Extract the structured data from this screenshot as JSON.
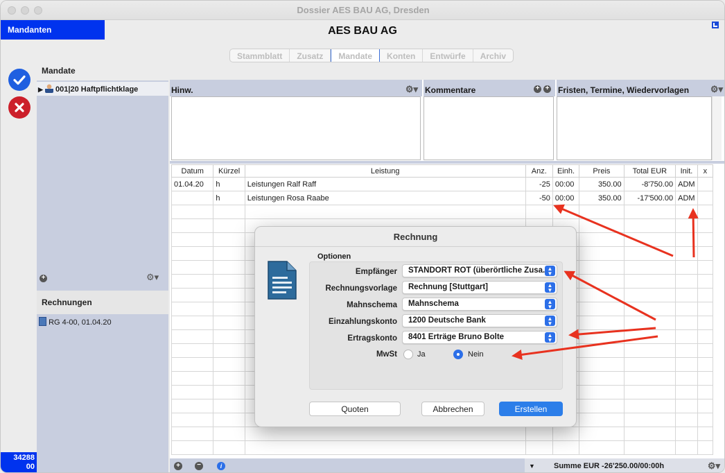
{
  "window": {
    "title": "Dossier AES BAU AG, Dresden"
  },
  "header": {
    "mandanten_tab": "Mandanten",
    "client_name": "AES BAU AG",
    "tabs": [
      {
        "label": "Stammblatt"
      },
      {
        "label": "Zusatz"
      },
      {
        "label": "Mandate"
      },
      {
        "label": "Konten"
      },
      {
        "label": "Entwürfe"
      },
      {
        "label": "Archiv"
      }
    ],
    "active_tab": "Mandate"
  },
  "left": {
    "confirm_icon": "checkmark-icon",
    "cancel_icon": "x-icon",
    "counter_line1": "34288",
    "counter_line2": "00"
  },
  "sidebar": {
    "mandate_header": "Mandate",
    "mandate_item": "001|20 Haftpflichtklage",
    "rechnungen_header": "Rechnungen",
    "rechnung_item": "RG 4-00, 01.04.20"
  },
  "notes": {
    "hinw": "Hinw.",
    "kommentare": "Kommentare",
    "fristen": "Fristen, Termine, Wiedervorlagen"
  },
  "table": {
    "headers": [
      "Datum",
      "Kürzel",
      "Leistung",
      "Anz.",
      "Einh.",
      "Preis",
      "Total EUR",
      "Init.",
      "x"
    ],
    "rows": [
      [
        "01.04.20",
        "h",
        "Leistungen Ralf Raff",
        "-25",
        "00:00",
        "350.00",
        "-8'750.00",
        "ADM",
        ""
      ],
      [
        "",
        "h",
        "Leistungen Rosa Raabe",
        "-50",
        "00:00",
        "350.00",
        "-17'500.00",
        "ADM",
        ""
      ]
    ]
  },
  "footer": {
    "summe": "Summe EUR -26'250.00/00:00h"
  },
  "dialog": {
    "title": "Rechnung",
    "options_label": "Optionen",
    "fields": {
      "empfaenger_label": "Empfänger",
      "empfaenger_value": "STANDORT ROT (überörtliche Zusa...",
      "vorlage_label": "Rechnungsvorlage",
      "vorlage_value": "Rechnung [Stuttgart]",
      "mahn_label": "Mahnschema",
      "mahn_value": "Mahnschema",
      "einz_label": "Einzahlungskonto",
      "einz_value": "1200 Deutsche Bank",
      "ertrag_label": "Ertragskonto",
      "ertrag_value": "8401 Erträge Bruno Bolte",
      "mwst_label": "MwSt",
      "mwst_ja": "Ja",
      "mwst_nein": "Nein",
      "mwst_selected": "Nein"
    },
    "buttons": {
      "quoten": "Quoten",
      "abbrechen": "Abbrechen",
      "erstellen": "Erstellen"
    }
  },
  "colors": {
    "accent_blue": "#0033ee",
    "annotation_red": "#e8321f",
    "panel_blue": "#c8cedf"
  }
}
